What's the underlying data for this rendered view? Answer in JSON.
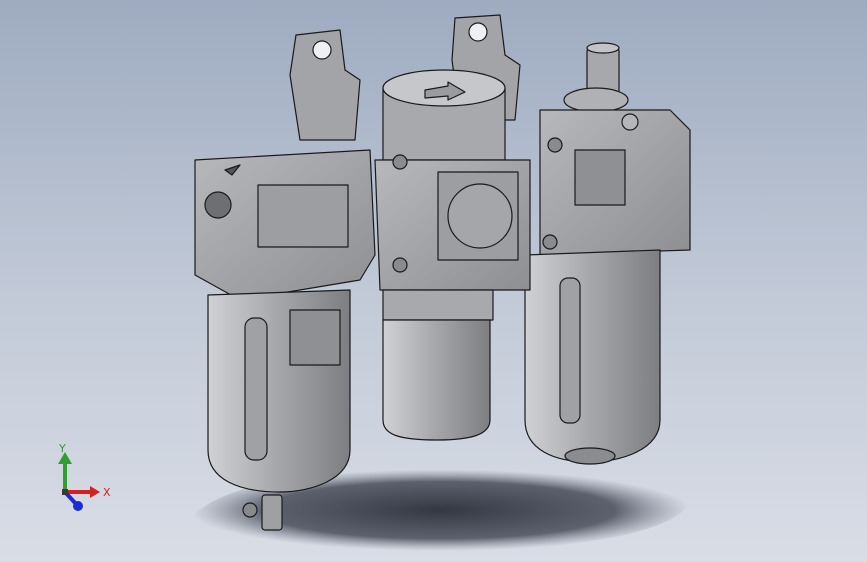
{
  "viewport": {
    "background_top": "#9eabc0",
    "background_bottom": "#d9dde6"
  },
  "model": {
    "part_color": "#9a9b9e",
    "edge_color": "#1a1a1a",
    "shadow_color": "#3f4350"
  },
  "triad": {
    "x_label": "X",
    "y_label": "Y",
    "x_color": "#d62020",
    "y_color": "#2fa02f",
    "z_color": "#1c2bd6"
  }
}
